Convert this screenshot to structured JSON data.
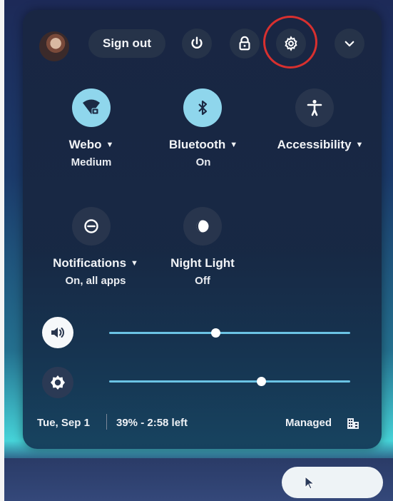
{
  "header": {
    "sign_out_label": "Sign out"
  },
  "feature_tiles": [
    {
      "label": "Webo",
      "sublabel": "Medium",
      "icon": "wifi-lock-icon",
      "active": true
    },
    {
      "label": "Bluetooth",
      "sublabel": "On",
      "icon": "bluetooth-icon",
      "active": true
    },
    {
      "label": "Accessibility",
      "sublabel": "",
      "icon": "accessibility-icon",
      "active": false
    },
    {
      "label": "Notifications",
      "sublabel": "On, all apps",
      "icon": "notifications-icon",
      "active": false
    },
    {
      "label": "Night Light",
      "sublabel": "Off",
      "icon": "night-light-icon",
      "active": false
    }
  ],
  "sliders": {
    "volume": {
      "icon": "speaker-icon",
      "level_fraction": 0.44
    },
    "brightness": {
      "icon": "brightness-icon",
      "level_fraction": 0.63
    }
  },
  "status": {
    "date": "Tue, Sep 1",
    "battery": "39% - 2:58 left",
    "managed": "Managed"
  },
  "colors": {
    "accent_active": "#8fd6ec",
    "slider_track": "#6bc3e4",
    "highlight_ring": "#d8302f"
  }
}
